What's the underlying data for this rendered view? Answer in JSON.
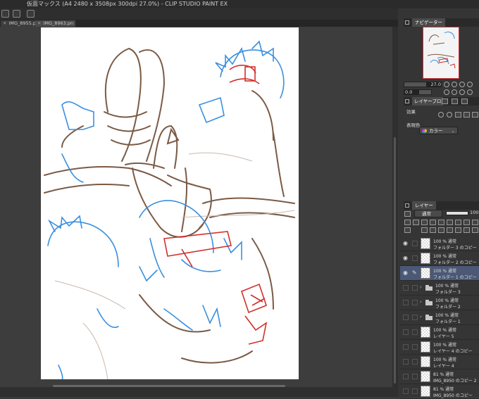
{
  "window": {
    "title": "仮面マックス (A4 2480 x 3508px 300dpi 27.0%) - CLIP STUDIO PAINT EX"
  },
  "tabs": [
    {
      "label": "IMG_8955.pn"
    },
    {
      "label": "IMG_8963.pn"
    }
  ],
  "navigator": {
    "title": "ナビゲーター",
    "zoom": "27.0",
    "rotation": "0.0"
  },
  "layer_property": {
    "title": "レイヤープロ",
    "effect_label": "効果",
    "expression_color_label": "表現色",
    "expression_color_value": "カラー"
  },
  "layer_panel": {
    "title": "レイヤー",
    "blend_mode": "通常",
    "opacity": "100"
  },
  "layers": [
    {
      "line1": "100 % 通常",
      "line2": "フォルダー 3 のコピー",
      "type": "layer",
      "visible": true,
      "selected": false
    },
    {
      "line1": "100 % 通常",
      "line2": "フォルダー 2 のコピー",
      "type": "layer",
      "visible": true,
      "selected": false
    },
    {
      "line1": "100 % 通常",
      "line2": "フォルダー 1 のコピー",
      "type": "layer",
      "visible": true,
      "selected": true
    },
    {
      "line1": "100 % 通常",
      "line2": "フォルダー 3",
      "type": "folder",
      "visible": false,
      "selected": false
    },
    {
      "line1": "100 % 通常",
      "line2": "フォルダー 2",
      "type": "folder",
      "visible": false,
      "selected": false
    },
    {
      "line1": "100 % 通常",
      "line2": "フォルダー 1",
      "type": "folder",
      "visible": false,
      "selected": false
    },
    {
      "line1": "100 % 通常",
      "line2": "レイヤー 5",
      "type": "layer",
      "visible": false,
      "selected": false
    },
    {
      "line1": "100 % 通常",
      "line2": "レイヤー 4 のコピー",
      "type": "layer",
      "visible": false,
      "selected": false
    },
    {
      "line1": "100 % 通常",
      "line2": "レイヤー 4",
      "type": "layer",
      "visible": false,
      "selected": false
    },
    {
      "line1": "81 % 通常",
      "line2": "IMG_8950 のコピー 2",
      "type": "layer",
      "visible": false,
      "selected": false
    },
    {
      "line1": "81 % 通常",
      "line2": "IMG_8950 のコピー",
      "type": "layer",
      "visible": false,
      "selected": false
    }
  ],
  "colors": {
    "accent_selection": "#4b5876",
    "sketch_brown": "#7a5a45",
    "sketch_blue": "#3a8fe0",
    "sketch_red": "#d0302a"
  }
}
